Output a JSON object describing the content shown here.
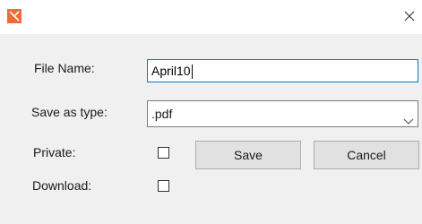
{
  "titlebar": {
    "app_icon": "app-logo-icon",
    "close_icon": "close-icon",
    "close_glyph": "✕"
  },
  "form": {
    "file_name_label": "File Name:",
    "file_name_value": "April10",
    "save_as_type_label": "Save as type:",
    "save_as_type_value": ".pdf",
    "private_label": "Private:",
    "private_checked": false,
    "download_label": "Download:",
    "download_checked": false
  },
  "buttons": {
    "save_label": "Save",
    "cancel_label": "Cancel"
  },
  "colors": {
    "accent": "#f06b3a",
    "focus_border": "#0078d7",
    "button_bg": "#e1e1e1",
    "dialog_bg": "#f0f0f0"
  }
}
